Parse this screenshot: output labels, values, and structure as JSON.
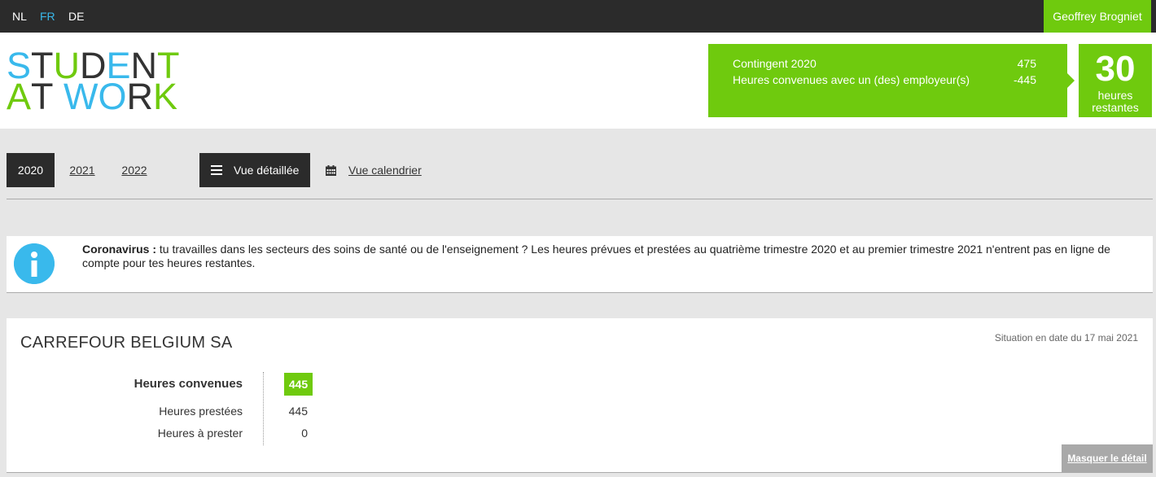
{
  "topbar": {
    "languages": [
      {
        "code": "NL",
        "active": false
      },
      {
        "code": "FR",
        "active": true
      },
      {
        "code": "DE",
        "active": false
      }
    ],
    "user_name": "Geoffrey Brogniet"
  },
  "logo": {
    "line1": "STUDENT",
    "line2": "AT WORK"
  },
  "contingent": {
    "row1_label": "Contingent 2020",
    "row1_value": "475",
    "row2_label": "Heures convenues avec un (des) employeur(s)",
    "row2_value": "-445",
    "remaining_number": "30",
    "remaining_label_1": "heures",
    "remaining_label_2": "restantes"
  },
  "toolbar": {
    "years": [
      "2020",
      "2021",
      "2022"
    ],
    "active_year": "2020",
    "detailed_view_label": "Vue détaillée",
    "calendar_view_label": "Vue calendrier"
  },
  "info": {
    "title": "Coronavirus :",
    "text": "tu travailles dans les secteurs des soins de santé ou de l'enseignement ? Les heures prévues et prestées au quatrième trimestre 2020 et au premier trimestre 2021 n'entrent pas en ligne de compte pour tes heures restantes."
  },
  "employer": {
    "name": "CARREFOUR BELGIUM SA",
    "situation": "Situation en date du 17 mai 2021",
    "agreed_label": "Heures convenues",
    "agreed_value": "445",
    "performed_label": "Heures prestées",
    "performed_value": "445",
    "remaining_label": "Heures à prester",
    "remaining_value": "0",
    "hide_detail_label": "Masquer le détail"
  },
  "colors": {
    "green": "#6fca0e",
    "blue": "#39b9ec",
    "dark": "#2b2b2b"
  }
}
